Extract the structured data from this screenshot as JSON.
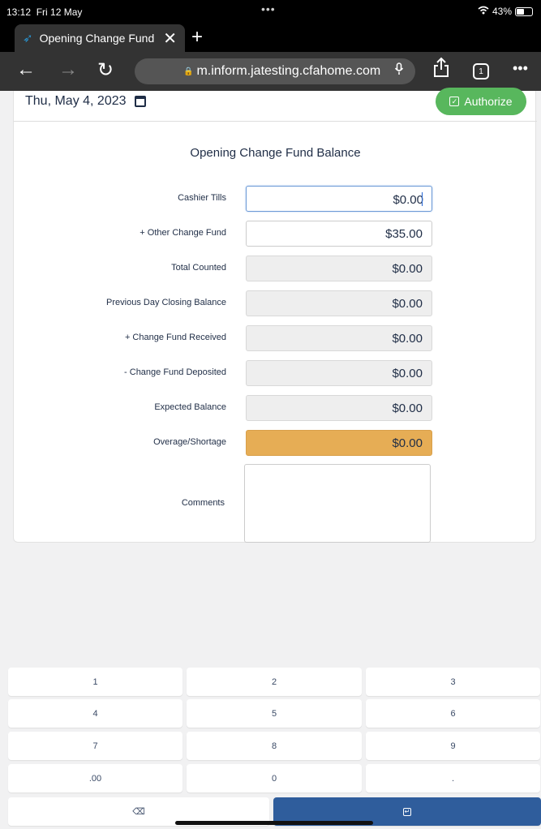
{
  "status": {
    "time": "13:12",
    "date": "Fri 12 May",
    "dots": "•••",
    "wifi": "wifi",
    "battery": "43%"
  },
  "tab": {
    "title": "Opening Change Fund",
    "close": "✕",
    "new_tab": "+"
  },
  "toolbar": {
    "back": "←",
    "forward": "→",
    "reload": "↻",
    "url": "m.inform.jatesting.cfahome.com",
    "mic": "🎙",
    "share": "⇪",
    "tab_count": "1",
    "more": "•••"
  },
  "header": {
    "date": "Thu, May 4, 2023",
    "authorize_label": "Authorize"
  },
  "form": {
    "title": "Opening Change Fund Balance",
    "rows": [
      {
        "label": "Cashier Tills",
        "value": "$0.00"
      },
      {
        "label": "+ Other Change Fund",
        "value": "$35.00"
      },
      {
        "label": "Total Counted",
        "value": "$0.00"
      },
      {
        "label": "Previous Day Closing Balance",
        "value": "$0.00"
      },
      {
        "label": "+ Change Fund Received",
        "value": "$0.00"
      },
      {
        "label": "- Change Fund Deposited",
        "value": "$0.00"
      },
      {
        "label": "Expected Balance",
        "value": "$0.00"
      },
      {
        "label": "Overage/Shortage",
        "value": "$0.00"
      }
    ],
    "comments_label": "Comments",
    "overage_color": "#e6ad55"
  },
  "keypad": {
    "keys": [
      "1",
      "2",
      "3",
      "4",
      "5",
      "6",
      "7",
      "8",
      "9",
      ".00",
      "0",
      "."
    ],
    "backspace": "⌫",
    "enter_color": "#2f5d9c"
  }
}
